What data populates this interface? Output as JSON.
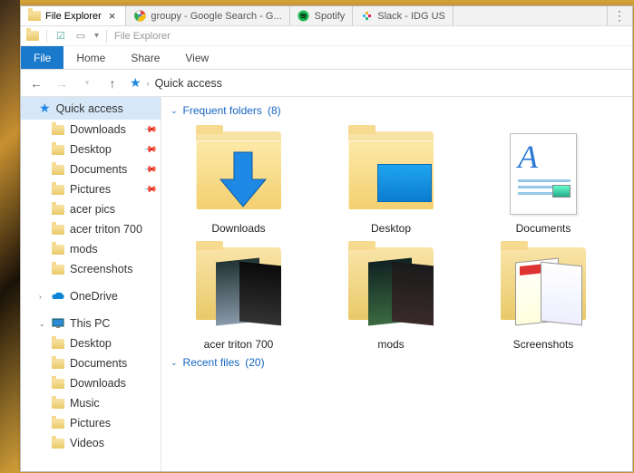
{
  "tabs": [
    {
      "label": "File Explorer",
      "icon": "folder"
    },
    {
      "label": "groupy - Google Search - G...",
      "icon": "chrome"
    },
    {
      "label": "Spotify",
      "icon": "spotify"
    },
    {
      "label": "Slack - IDG US",
      "icon": "slack"
    }
  ],
  "qat_title": "File Explorer",
  "ribbon": {
    "file": "File",
    "home": "Home",
    "share": "Share",
    "view": "View"
  },
  "breadcrumb": {
    "location": "Quick access"
  },
  "sidebar": {
    "quick_access": "Quick access",
    "pinned": [
      {
        "label": "Downloads",
        "icon": "folder"
      },
      {
        "label": "Desktop",
        "icon": "folder"
      },
      {
        "label": "Documents",
        "icon": "folder"
      },
      {
        "label": "Pictures",
        "icon": "folder"
      },
      {
        "label": "acer pics",
        "icon": "folder"
      },
      {
        "label": "acer triton 700",
        "icon": "folder"
      },
      {
        "label": "mods",
        "icon": "folder"
      },
      {
        "label": "Screenshots",
        "icon": "folder"
      }
    ],
    "onedrive": "OneDrive",
    "thispc": "This PC",
    "pc_items": [
      {
        "label": "Desktop"
      },
      {
        "label": "Documents"
      },
      {
        "label": "Downloads"
      },
      {
        "label": "Music"
      },
      {
        "label": "Pictures"
      },
      {
        "label": "Videos"
      }
    ]
  },
  "sections": {
    "frequent": {
      "label": "Frequent folders",
      "count": 8
    },
    "recent": {
      "label": "Recent files",
      "count": 20
    }
  },
  "folders": [
    {
      "label": "Downloads",
      "kind": "downloads"
    },
    {
      "label": "Desktop",
      "kind": "desktop"
    },
    {
      "label": "Documents",
      "kind": "documents"
    },
    {
      "label": "acer triton 700",
      "kind": "preview-a"
    },
    {
      "label": "mods",
      "kind": "preview-b"
    },
    {
      "label": "Screenshots",
      "kind": "preview-c"
    }
  ]
}
